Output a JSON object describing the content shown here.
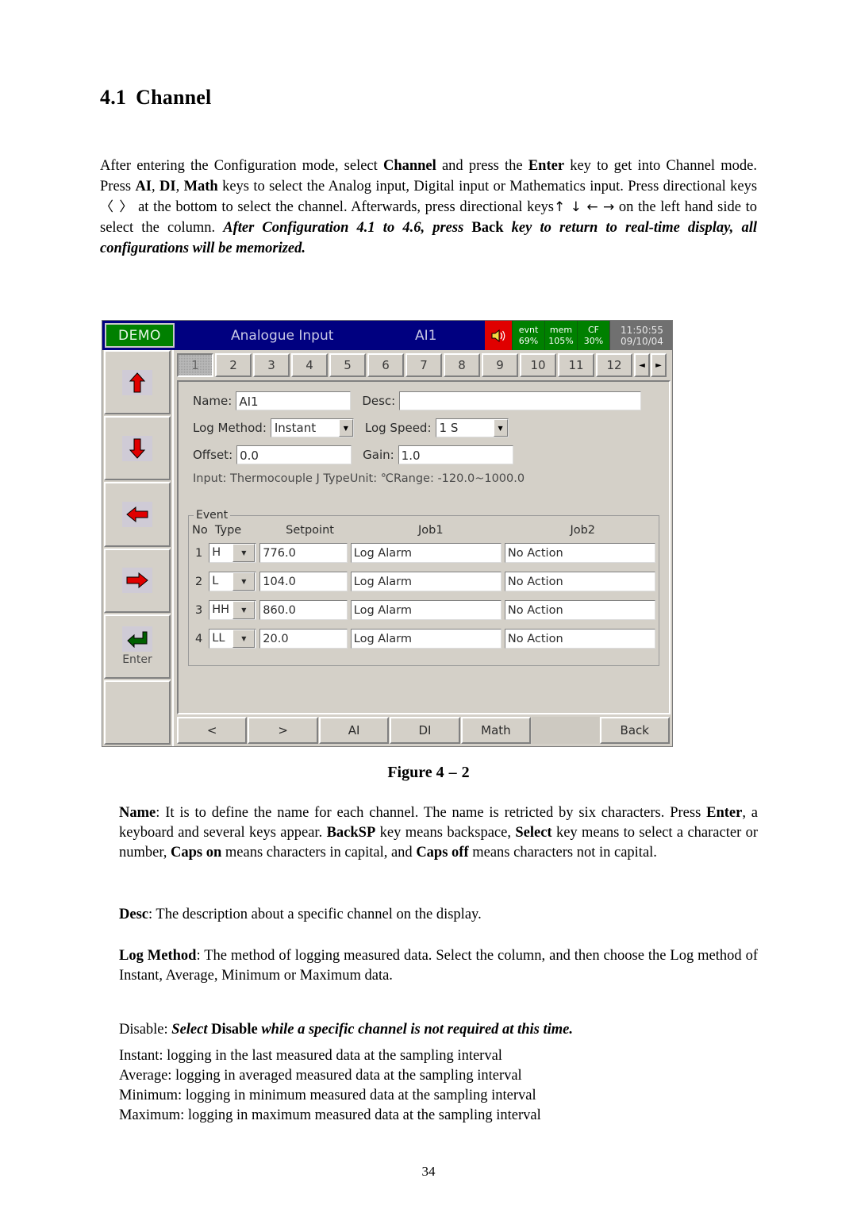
{
  "heading": {
    "number": "4.1",
    "title": "Channel"
  },
  "intro": {
    "seg1": "After entering the Configuration mode, select ",
    "b1": "Channel",
    "seg2": " and press the ",
    "b2": "Enter",
    "seg3": " key to get into Channel mode. Press ",
    "b3": "AI",
    "seg4": ", ",
    "b4": "DI",
    "seg5": ", ",
    "b5": "Math",
    "seg6": " keys to select the Analog input, Digital input or Mathematics input. Press directional keys ",
    "glyph1": "〈 〉",
    "seg7": " at the bottom to select the channel. Afterwards, press directional keys",
    "glyph2": "↑ ↓ ← →",
    "seg8": " on the left hand side to select the column.   ",
    "bi1": "After Configuration 4.1 to 4.6, press ",
    "b6": "Back",
    "bi2": " key to return to real-time display, all configurations will be memorized."
  },
  "device": {
    "titlebar": {
      "demo_badge": "DEMO",
      "mode_label": "Analogue Input",
      "channel_label": "AI1",
      "speaker_icon": "speaker-icon",
      "status": [
        {
          "name": "evnt",
          "value": "69%"
        },
        {
          "name": "mem",
          "value": "105%"
        },
        {
          "name": "CF",
          "value": "30%"
        }
      ],
      "time": "11:50:55",
      "date": "09/10/04"
    },
    "keypad": [
      {
        "icon": "arrow-up-icon",
        "label": ""
      },
      {
        "icon": "arrow-down-icon",
        "label": ""
      },
      {
        "icon": "arrow-left-icon",
        "label": ""
      },
      {
        "icon": "arrow-right-icon",
        "label": ""
      },
      {
        "icon": "enter-arrow-icon",
        "label": "Enter"
      },
      {
        "icon": "",
        "label": ""
      }
    ],
    "tabs": {
      "items": [
        "1",
        "2",
        "3",
        "4",
        "5",
        "6",
        "7",
        "8",
        "9",
        "10",
        "11",
        "12"
      ],
      "selected_index": 0,
      "scroll_left": "◄",
      "scroll_right": "►"
    },
    "form": {
      "name_label": "Name:",
      "name_value": "AI1",
      "desc_label": "Desc:",
      "desc_value": "",
      "log_method_label": "Log Method:",
      "log_method_value": "Instant",
      "log_speed_label": "Log Speed:",
      "log_speed_value": "1 S",
      "offset_label": "Offset:",
      "offset_value": "0.0",
      "gain_label": "Gain:",
      "gain_value": "1.0",
      "input_info": "Input: Thermocouple J Type",
      "unit_info": "Unit: ℃",
      "range_info": "Range: -120.0~1000.0"
    },
    "event": {
      "legend": "Event",
      "headers": [
        "No",
        "Type",
        "Setpoint",
        "Job1",
        "Job2"
      ],
      "rows": [
        {
          "no": "1",
          "type": "H",
          "setpoint": "776.0",
          "job1": "Log Alarm",
          "job2": "No Action"
        },
        {
          "no": "2",
          "type": "L",
          "setpoint": "104.0",
          "job1": "Log Alarm",
          "job2": "No Action"
        },
        {
          "no": "3",
          "type": "HH",
          "setpoint": "860.0",
          "job1": "Log Alarm",
          "job2": "No Action"
        },
        {
          "no": "4",
          "type": "LL",
          "setpoint": "20.0",
          "job1": "Log Alarm",
          "job2": "No Action"
        }
      ]
    },
    "toolbar": [
      "<",
      ">",
      "AI",
      "DI",
      "Math",
      "",
      "Back"
    ]
  },
  "figure_caption": {
    "prefix": "Figure 4",
    "dash": "–",
    "number": "2"
  },
  "body": {
    "name_para": {
      "b1": "Name",
      "t1": ":  It is to define the name for each channel.  The name is retricted by six characters. Press ",
      "b2": "Enter",
      "t2": ", a keyboard and several keys appear. ",
      "b3": "BackSP",
      "t3": " key means backspace, ",
      "b4": "Select",
      "t4": " key means to select a character or number, ",
      "b5": "Caps on",
      "t5": " means characters in capital, and ",
      "b6": "Caps off",
      "t6": " means characters not in capital."
    },
    "desc_para": {
      "b1": "Desc",
      "t1": ":  The description about a specific channel on the display."
    },
    "log_para": {
      "b1": "Log Method",
      "t1": ": The method of logging measured data. Select the column, and then choose the Log method of Instant, Average, Minimum or Maximum data."
    },
    "disable_para": {
      "t1": "Disable:  ",
      "bi1": "Select ",
      "b1": "Disable",
      "bi2": " while a specific channel is not required at this time."
    },
    "list": [
      "Instant: logging in the last measured data at the sampling interval",
      "Average:  logging in averaged measured data at the sampling interval",
      "Minimum: logging in minimum measured data at the sampling interval",
      "Maximum: logging in maximum measured data at the sampling interval"
    ]
  },
  "page_number": "34",
  "colors": {
    "titlebar_blue": "#000080",
    "badge_green": "#008000",
    "speaker_red": "#e00000",
    "face_gray": "#d4d0c8",
    "arrow_red": "#e00000",
    "enter_green": "#006000"
  }
}
